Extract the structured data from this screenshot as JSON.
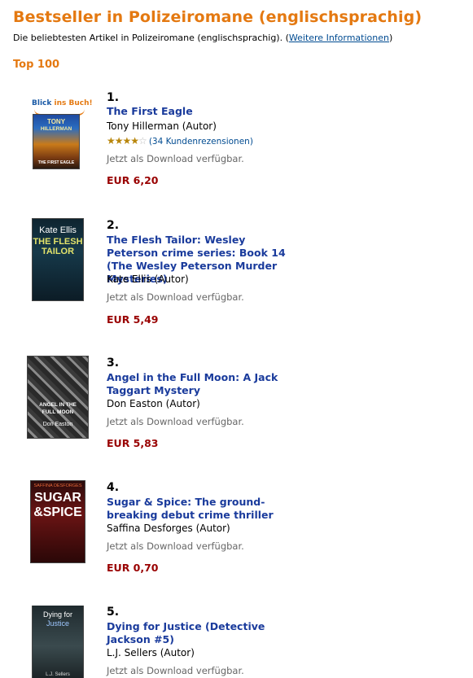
{
  "header": {
    "title": "Bestseller in Polizeiromane (englischsprachig)",
    "subtitle": "Die beliebtesten Artikel in Polizeiromane (englischsprachig).",
    "more_info_link": "Weitere Informationen",
    "section": "Top 100"
  },
  "look_inside": {
    "part1": "Blick",
    "part2": "ins Buch!"
  },
  "items": [
    {
      "rank": "1.",
      "title": "The First Eagle",
      "author": "Tony Hillerman (Autor)",
      "rating_stars": 3.5,
      "reviews": "(34 Kundenrezensionen)",
      "availability": "Jetzt als Download verfügbar.",
      "price": "EUR 6,20",
      "cover_lines": [
        "TONY",
        "HILLERMAN",
        "THE FIRST EAGLE"
      ]
    },
    {
      "rank": "2.",
      "title": "The Flesh Tailor: Wesley Peterson crime series: Book 14 (The Wesley Peterson Murder Mysteries)",
      "author": "Kate Ellis (Autor)",
      "availability": "Jetzt als Download verfügbar.",
      "price": "EUR 5,49",
      "cover_lines": [
        "Kate Ellis",
        "THE FLESH",
        "TAILOR"
      ]
    },
    {
      "rank": "3.",
      "title": "Angel in the Full Moon: A Jack Taggart Mystery",
      "author": "Don Easton (Autor)",
      "availability": "Jetzt als Download verfügbar.",
      "price": "EUR 5,83",
      "cover_lines": [
        "ANGEL IN THE",
        "FULL MOON",
        "Don Easton"
      ]
    },
    {
      "rank": "4.",
      "title": "Sugar & Spice: The ground-breaking debut crime thriller",
      "author": "Saffina Desforges (Autor)",
      "availability": "Jetzt als Download verfügbar.",
      "price": "EUR 0,70",
      "cover_lines": [
        "SAFFINA DESFORGES",
        "SUGAR",
        "&SPICE"
      ]
    },
    {
      "rank": "5.",
      "title": "Dying for Justice (Detective Jackson #5)",
      "author": "L.J. Sellers (Autor)",
      "availability": "Jetzt als Download verfügbar.",
      "cover_lines": [
        "Dying for",
        "Justice",
        "L.J. Sellers"
      ]
    }
  ]
}
